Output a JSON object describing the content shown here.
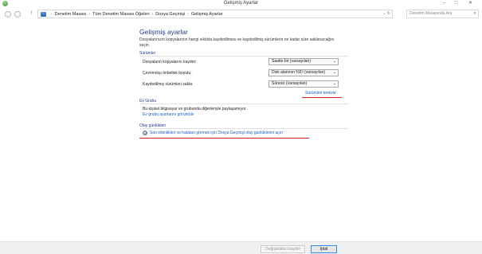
{
  "window": {
    "title": "Gelişmiş Ayarlar",
    "minimize": "–",
    "maximize": "□",
    "close": "✕"
  },
  "nav": {
    "back": "←",
    "forward": "→",
    "up": "↑",
    "breadcrumbs": [
      "Denetim Masası",
      "Tüm Denetim Masası Öğeleri",
      "Dosya Geçmişi",
      "Gelişmiş Ayarlar"
    ],
    "separator": "›",
    "address_controls": "⌄  ↻",
    "search_placeholder": "Denetim Masasında Ara"
  },
  "main": {
    "title": "Gelişmiş ayarlar",
    "description": "Dosyalarınızın kopyalarının hangi sıklıkta kaydedilmesi ve kaydedilmiş sürümlerin ne kadar süre saklanacağını seçin.",
    "versions": {
      "header": "Sürümler",
      "rows": [
        {
          "label": "Dosyaların kopyalarını kaydet:",
          "value": "Saatte bir (varsayılan)"
        },
        {
          "label": "Çevrimdışı önbellek boyutu:",
          "value": "Disk alanının %5'i (varsayılan)"
        },
        {
          "label": "Kaydedilmiş sürümleri sakla:",
          "value": "Süresiz (varsayılan)"
        }
      ],
      "cleanup_link": "Sürümleri temizle"
    },
    "homegroup": {
      "header": "Ev Grubu",
      "text": "Bu kişisel bilgisayar ev grubunda diğerleriyle paylaşamıyor.",
      "link": "Ev grubu ayarlarını görüntüle"
    },
    "eventlogs": {
      "header": "Olay günlükleri",
      "link": "Son etkinlikleri ve hataları görmek için Dosya Geçmişi olay günlüklerini açın"
    }
  },
  "footer": {
    "save_label": "Değişiklikleri kaydet",
    "cancel_label": "İptal"
  },
  "colors": {
    "heading_blue": "#1f3d8c",
    "link_blue": "#1a5dc2",
    "annotation_red": "#d2201c"
  }
}
